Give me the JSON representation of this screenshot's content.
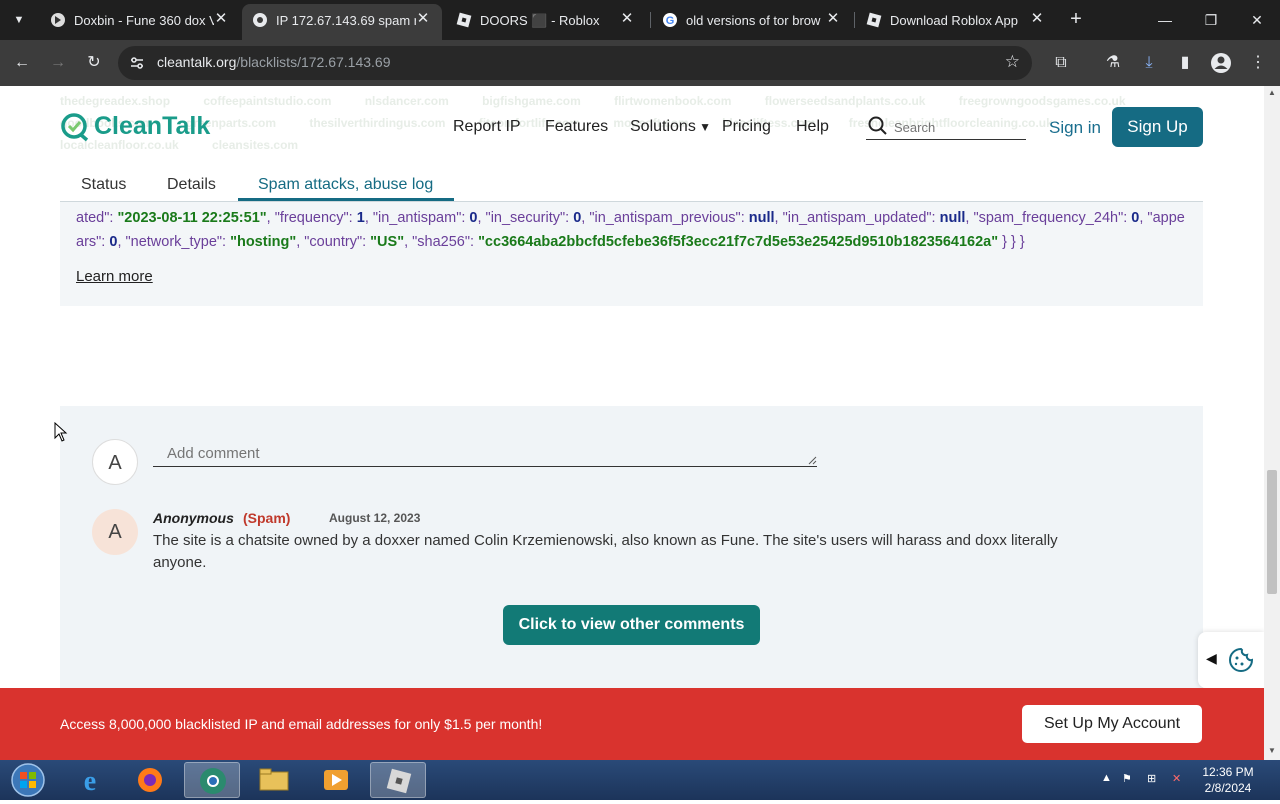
{
  "browser": {
    "tabs": [
      {
        "title": "Doxbin - Fune 360 dox V",
        "active": false
      },
      {
        "title": "IP 172.67.143.69 spam r",
        "active": true
      },
      {
        "title": "DOORS ⬛ - Roblox",
        "active": false
      },
      {
        "title": "old versions of tor brow",
        "active": false
      },
      {
        "title": "Download Roblox App",
        "active": false
      }
    ],
    "url_host": "cleantalk.org",
    "url_path": "/blacklists/172.67.143.69"
  },
  "site": {
    "logo": "CleanTalk",
    "bg_words": "thedegreadex.shop   coffeepaintstudio.com   nlsdancer.com   bigfishgame.com   flirtwomenbook.com   flowerseedsandplants.co.uk   freegrowngoodsgames.co.uk   goodbooks.com   greenparts.com   thesilverthirdingus.com   fitcomfortlife.com   mopsoft.com   blaaeliftess.com   freshcleanbrightfloorcleaning.co.uk   localcleanfloor.co.uk   cleansites.com",
    "nav": {
      "report_ip": "Report IP",
      "features": "Features",
      "solutions": "Solutions",
      "pricing": "Pricing",
      "help": "Help"
    },
    "search_placeholder": "Search",
    "sign_in": "Sign in",
    "sign_up": "Sign Up"
  },
  "page_tabs": {
    "status": "Status",
    "details": "Details",
    "spam_log": "Spam attacks, abuse log"
  },
  "log": {
    "updated_val": "\"2023-08-11 22:25:51\"",
    "frequency_val": "1",
    "in_antispam_val": "0",
    "in_security_val": "0",
    "in_antispam_previous_val": "null",
    "in_antispam_updated_val": "null",
    "spam_frequency_val": "0",
    "appears_val": "0",
    "network_type_val": "\"hosting\"",
    "country_val": "\"US\"",
    "sha256_val": "\"cc3664aba2bbcfd5cfebe36f5f3ecc21f7c7d5e53e25425d9510b1823564162a\"",
    "learn_more": "Learn more"
  },
  "comments": {
    "my_avatar": "A",
    "placeholder": "Add comment",
    "items": [
      {
        "avatar": "A",
        "author": "Anonymous",
        "flag": "(Spam)",
        "date": "August 12, 2023",
        "text": "The site is a chatsite owned by a doxxer named Colin Krzemienowski, also known as Fune. The site's users will harass and doxx literally anyone."
      }
    ],
    "view_more": "Click to view other comments"
  },
  "promo": {
    "text": "Access 8,000,000 blacklisted IP and email addresses for only $1.5 per month!",
    "button": "Set Up My Account"
  },
  "taskbar": {
    "time": "12:36 PM",
    "date": "2/8/2024"
  },
  "colors": {
    "brand_teal": "#156b83",
    "logo_green": "#1a9c8a",
    "promo_red": "#d9332e",
    "spam_red": "#c0392b"
  }
}
